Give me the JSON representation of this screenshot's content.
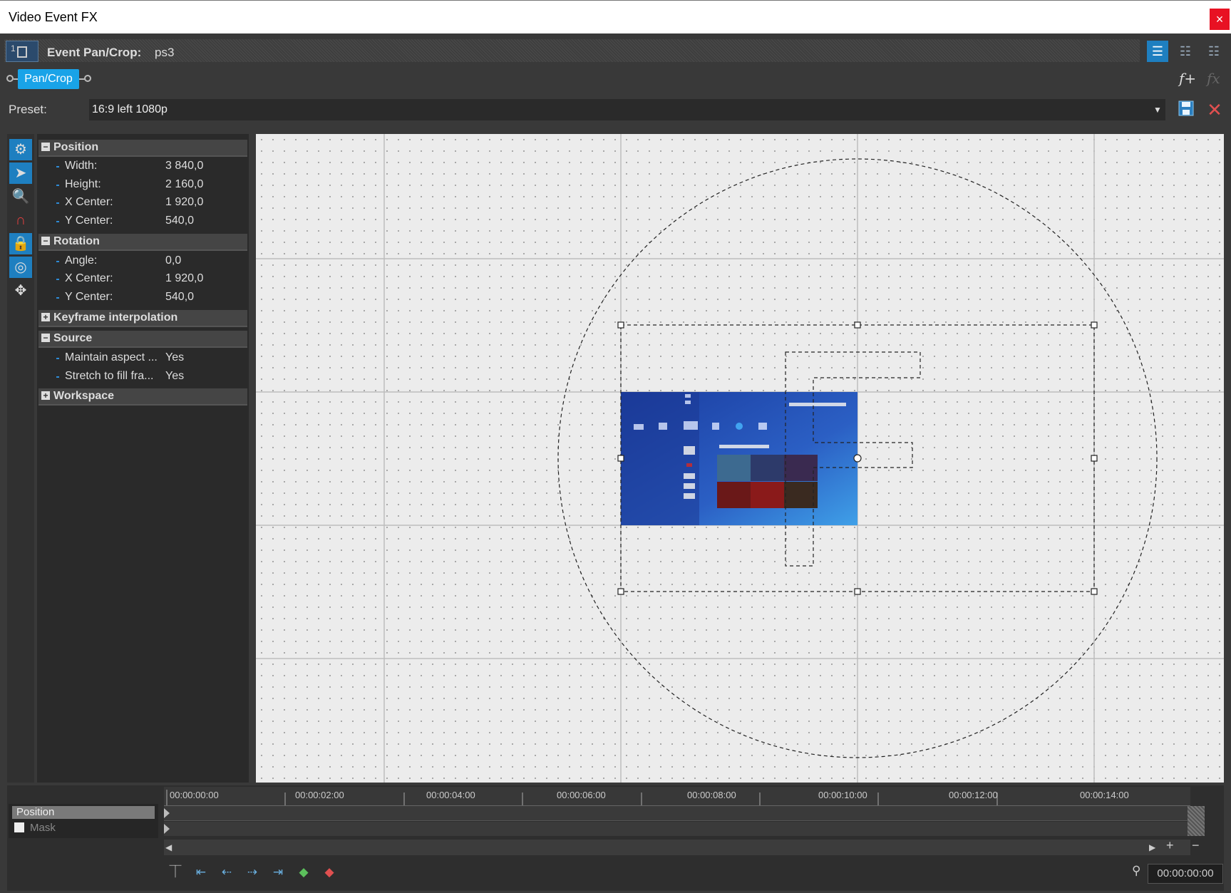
{
  "window": {
    "title": "Video Event FX",
    "close_label": "×"
  },
  "header": {
    "label": "Event Pan/Crop:",
    "name": "ps3"
  },
  "chain": {
    "tab_label": "Pan/Crop",
    "add_fx": "f+",
    "remove_fx": "fx"
  },
  "preset": {
    "label": "Preset:",
    "value": "16:9 left 1080p"
  },
  "groups": {
    "position": {
      "label": "Position",
      "sign": "−",
      "rows": [
        {
          "label": "Width:",
          "value": "3 840,0"
        },
        {
          "label": "Height:",
          "value": "2 160,0"
        },
        {
          "label": "X Center:",
          "value": "1 920,0"
        },
        {
          "label": "Y Center:",
          "value": "540,0"
        }
      ]
    },
    "rotation": {
      "label": "Rotation",
      "sign": "−",
      "rows": [
        {
          "label": "Angle:",
          "value": "0,0"
        },
        {
          "label": "X Center:",
          "value": "1 920,0"
        },
        {
          "label": "Y Center:",
          "value": "540,0"
        }
      ]
    },
    "keyframe": {
      "label": "Keyframe interpolation",
      "sign": "+"
    },
    "source": {
      "label": "Source",
      "sign": "−",
      "rows": [
        {
          "label": "Maintain aspect ...",
          "value": "Yes"
        },
        {
          "label": "Stretch to fill fra...",
          "value": "Yes"
        }
      ]
    },
    "workspace": {
      "label": "Workspace",
      "sign": "+"
    }
  },
  "timeline": {
    "tracks": [
      "Position",
      "Mask"
    ],
    "ticks": [
      "00:00:00:00",
      "00:00:02:00",
      "00:00:04:00",
      "00:00:06:00",
      "00:00:08:00",
      "00:00:10:00",
      "00:00:12:00",
      "00:00:14:00"
    ],
    "time": "00:00:00:00"
  },
  "colors": {
    "accent": "#19a3e8",
    "close": "#e81123",
    "canvas": "#ececec",
    "panel": "#393939"
  }
}
